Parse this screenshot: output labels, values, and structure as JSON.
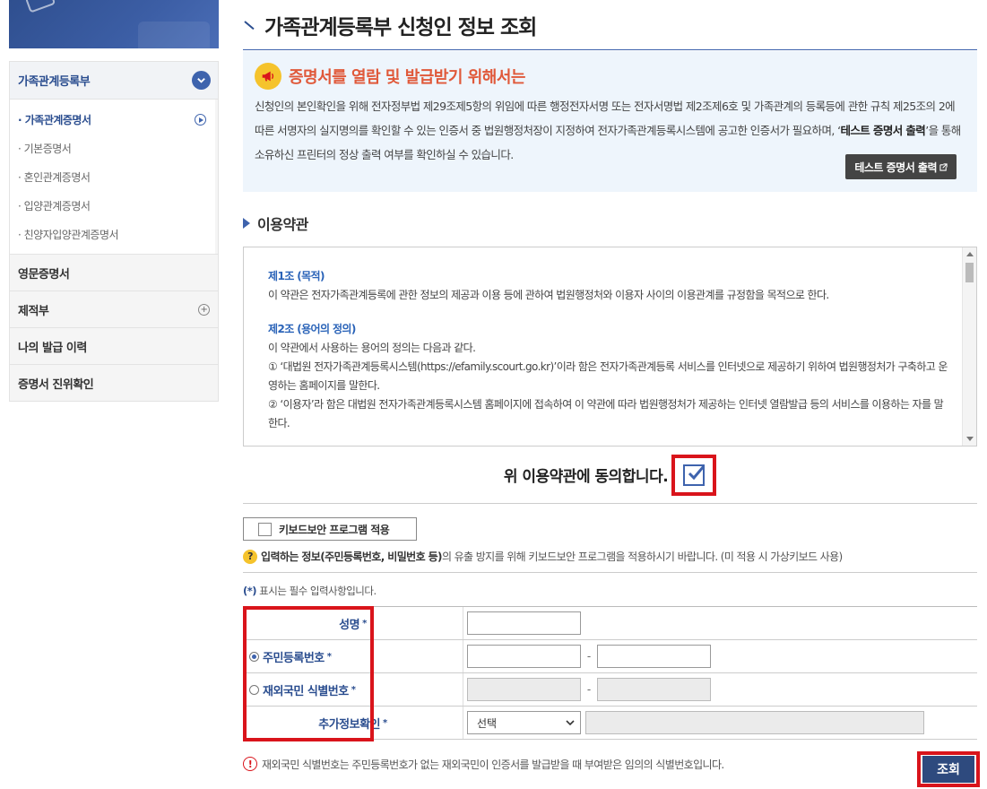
{
  "sidebar": {
    "section_title": "가족관계등록부",
    "sub_items": [
      {
        "label": "· 가족관계증명서"
      },
      {
        "label": "· 기본증명서"
      },
      {
        "label": "· 혼인관계증명서"
      },
      {
        "label": "· 입양관계증명서"
      },
      {
        "label": "· 친양자입양관계증명서"
      }
    ],
    "menus": [
      {
        "label": "영문증명서"
      },
      {
        "label": "제적부"
      },
      {
        "label": "나의 발급 이력"
      },
      {
        "label": "증명서 진위확인"
      }
    ]
  },
  "page": {
    "title": "가족관계등록부 신청인 정보 조회"
  },
  "notice": {
    "title": "증명서를 열람 및 발급받기 위해서는",
    "body_1": "신청인의 본인확인을 위해 전자정부법 제29조제5항의 위임에 따른 행정전자서명 또는 전자서명법 제2조제6호 및 가족관계의 등록등에 관한 규칙 제25조의 2에 따른 서명자의 실지명의를 확인할 수 있는 인증서 중 법원행정처장이 지정하여 전자가족관계등록시스템에 공고한 인증서가 필요하며, ‘",
    "body_bold": "테스트 증명서 출력",
    "body_2": "’을 통해 소유하신 프린터의 정상 출력 여부를 확인하실 수 있습니다.",
    "test_button": "테스트 증명서 출력"
  },
  "terms": {
    "section_title": "이용약관",
    "article1_title": "제1조 (목적)",
    "article1_text": "이 약관은 전자가족관계등록에 관한 정보의 제공과 이용 등에 관하여 법원행정처와 이용자 사이의 이용관계를 규정함을 목적으로 한다.",
    "article2_title": "제2조 (용어의 정의)",
    "article2_intro": "이 약관에서 사용하는 용어의 정의는 다음과 같다.",
    "article2_item1": "① ‘대법원 전자가족관계등록시스템(https://efamily.scourt.go.kr)’이라 함은 전자가족관계등록 서비스를 인터넷으로 제공하기 위하여 법원행정처가 구축하고 운영하는 홈페이지를 말한다.",
    "article2_item2": "② ‘이용자’라 함은 대법원 전자가족관계등록시스템 홈페이지에 접속하여 이 약관에 따라 법원행정처가 제공하는 인터넷 열람발급 등의 서비스를 이용하는 자를 말한다.",
    "agree_label": "위 이용약관에 동의합니다.",
    "agree_checked": true
  },
  "keyboard": {
    "button_label": "키보드보안 프로그램 적용",
    "note_bold": "입력하는 정보(주민등록번호, 비밀번호 등)",
    "note_rest": "의 유출 방지를 위해 키보드보안 프로그램을 적용하시기 바랍니다. (미 적용 시 가상키보드 사용)"
  },
  "form": {
    "required_note_star": "(*)",
    "required_note": " 표시는 필수 입력사항입니다.",
    "name_label": "성명",
    "rrn_label": "주민등록번호",
    "foreign_label": "재외국민 식별번호",
    "extra_label": "추가정보확인",
    "required_mark": "*",
    "dash": "-",
    "select_value": "선택",
    "rrn_selected": true
  },
  "footer": {
    "note": "재외국민 식별번호는 주민등록번호가 없는 재외국민이 인증서를 발급받을 때 부여받은 임의의 식별번호입니다.",
    "search_button": "조회"
  },
  "colors": {
    "accent": "#3e63ad",
    "highlight": "#d9141b",
    "notice_title": "#e0593a"
  }
}
